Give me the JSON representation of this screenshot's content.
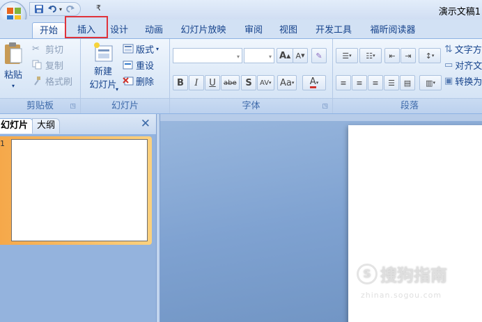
{
  "app": {
    "doc_title": "演示文稿1"
  },
  "qat": {
    "customize": "₹"
  },
  "tabs": [
    {
      "label": "开始"
    },
    {
      "label": "插入"
    },
    {
      "label": "设计"
    },
    {
      "label": "动画"
    },
    {
      "label": "幻灯片放映"
    },
    {
      "label": "审阅"
    },
    {
      "label": "视图"
    },
    {
      "label": "开发工具"
    },
    {
      "label": "福昕阅读器"
    }
  ],
  "ribbon": {
    "clipboard": {
      "label": "剪贴板",
      "paste": "粘贴",
      "cut": "剪切",
      "copy": "复制",
      "format_painter": "格式刷"
    },
    "slides": {
      "label": "幻灯片",
      "new_slide_line1": "新建",
      "new_slide_line2": "幻灯片",
      "layout": "版式",
      "reset": "重设",
      "delete": "删除"
    },
    "font": {
      "label": "字体",
      "bold": "B",
      "italic": "I",
      "underline": "U",
      "strike": "abe",
      "shadow": "S",
      "spacing": "AV",
      "case": "Aa",
      "color": "A",
      "grow": "A",
      "shrink": "A"
    },
    "paragraph": {
      "label": "段落",
      "text_direction": "文字方",
      "align_text": "对齐文",
      "convert": "转换为"
    }
  },
  "panel": {
    "tab_slides": "幻灯片",
    "tab_outline": "大纲",
    "close": "✕",
    "thumb_number": "1"
  },
  "watermark": {
    "text": "搜狗指南",
    "url": "zhinan.sogou.com"
  }
}
